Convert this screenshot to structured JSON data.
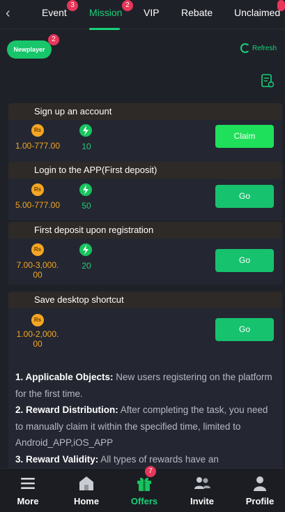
{
  "tabs": [
    {
      "label": "Event",
      "badge": "3"
    },
    {
      "label": "Mission",
      "badge": "2",
      "active": true
    },
    {
      "label": "VIP"
    },
    {
      "label": "Rebate"
    },
    {
      "label": "Unclaimed",
      "badge": ""
    }
  ],
  "sub": {
    "newplayer_label": "Newplayer",
    "newplayer_badge": "2",
    "refresh_label": "Refresh"
  },
  "currency_icon_text": "Rs",
  "tasks": [
    {
      "title": "Sign up an account",
      "amount": "1.00-777.00",
      "points": "10",
      "button": "Claim"
    },
    {
      "title": "Login to the APP(First deposit)",
      "amount": "5.00-777.00",
      "points": "50",
      "button": "Go"
    },
    {
      "title": "First deposit upon registration",
      "amount_line1": "7.00-3,000.",
      "amount_line2": "00",
      "points": "20",
      "button": "Go"
    },
    {
      "title": "Save desktop shortcut",
      "amount_line1": "1.00-2,000.",
      "amount_line2": "00",
      "button": "Go"
    }
  ],
  "rules": [
    {
      "label": "1. Applicable Objects:",
      "text": " New users registering on the platform for the first time."
    },
    {
      "label": "2. Reward Distribution:",
      "text": " After completing the task, you need to manually claim it within the specified time, limited to Android_APP,iOS_APP"
    },
    {
      "label": "3. Reward Validity:",
      "text": " All types of rewards have an"
    }
  ],
  "nav": [
    {
      "label": "More",
      "icon": "menu-icon"
    },
    {
      "label": "Home",
      "icon": "home-icon"
    },
    {
      "label": "Offers",
      "icon": "gift-icon",
      "badge": "7",
      "active": true
    },
    {
      "label": "Invite",
      "icon": "users-icon"
    },
    {
      "label": "Profile",
      "icon": "profile-icon"
    }
  ],
  "colors": {
    "accent": "#19d17a",
    "background": "#1f2128",
    "coin": "#f5a623",
    "badge": "#e8365a"
  }
}
